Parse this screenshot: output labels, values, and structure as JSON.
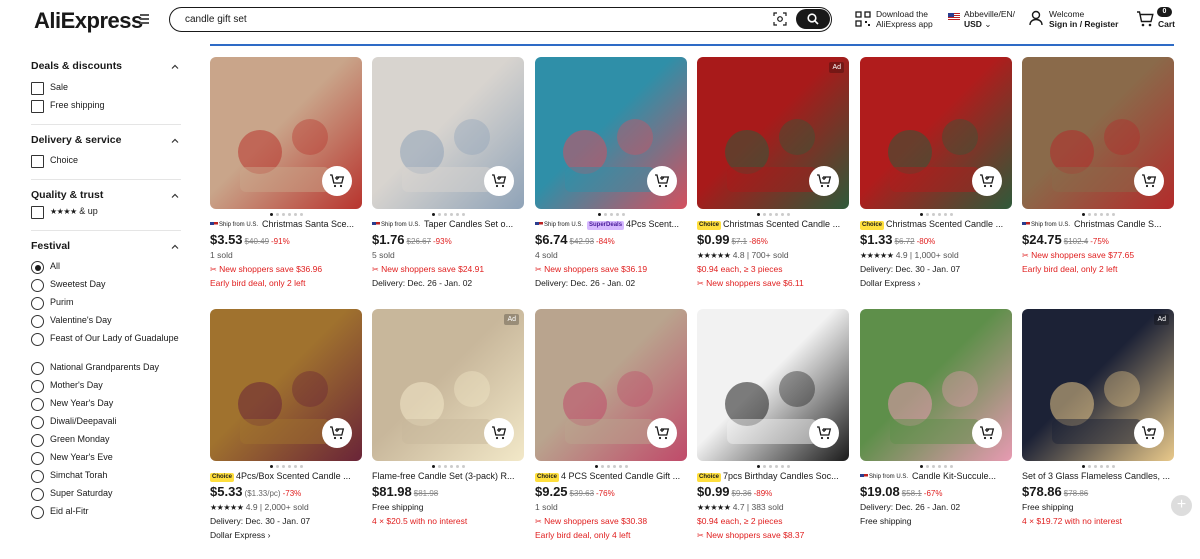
{
  "header": {
    "logo": "AliExpress",
    "search_value": "candle gift set",
    "app_line1": "Download the",
    "app_line2": "AliExpress app",
    "locale_line1": "Abbeville/EN/",
    "locale_line2": "USD",
    "welcome_line1": "Welcome",
    "welcome_line2": "Sign in / Register",
    "cart_count": "0",
    "cart_label": "Cart"
  },
  "sidebar": {
    "deals_title": "Deals & discounts",
    "deals": [
      "Sale",
      "Free shipping"
    ],
    "delivery_title": "Delivery & service",
    "delivery": [
      "Choice"
    ],
    "quality_title": "Quality & trust",
    "quality_stars": "★★★★",
    "quality_label": "& up",
    "festival_title": "Festival",
    "festival": [
      "All",
      "Sweetest Day",
      "Purim",
      "Valentine's Day",
      "Feast of Our Lady of Guadalupe",
      "National Grandparents Day",
      "Mother's Day",
      "New Year's Day",
      "Diwali/Deepavali",
      "Green Monday",
      "New Year's Eve",
      "Simchat Torah",
      "Super Saturday",
      "Eid al-Fitr"
    ]
  },
  "tags": {
    "ship_us": "Ship from U.S.",
    "choice": "Choice",
    "superdeals": "SuperDeals",
    "ad": "Ad"
  },
  "products": [
    {
      "title": "Christmas Santa Sce...",
      "price": "$3.53",
      "old": "$40.49",
      "disc": "-91%",
      "l1": "1 sold",
      "l2": "New shoppers save $36.96",
      "l3": "Early bird deal, only 2 left",
      "colors": [
        "#c9a58a",
        "#b8342e"
      ]
    },
    {
      "title": "Taper Candles Set o...",
      "price": "$1.76",
      "old": "$26.67",
      "disc": "-93%",
      "l1": "5 sold",
      "l2": "New shoppers save $24.91",
      "l3": "Delivery: Dec. 26 - Jan. 02",
      "colors": [
        "#d8d4cf",
        "#8fa3b8"
      ]
    },
    {
      "title": "4Pcs Scent...",
      "price": "$6.74",
      "old": "$42.93",
      "disc": "-84%",
      "l1": "4 sold",
      "l2": "New shoppers save $36.19",
      "l3": "Delivery: Dec. 26 - Jan. 02",
      "colors": [
        "#2f8fa8",
        "#d44f5e"
      ]
    },
    {
      "title": "Christmas Scented Candle ...",
      "price": "$0.99",
      "old": "$7.1",
      "disc": "-86%",
      "stars": "★★★★★",
      "l1": "4.8 | 700+ sold",
      "l2": "$0.94 each, ≥ 3 pieces",
      "l3": "New shoppers save $6.11",
      "colors": [
        "#a81a1a",
        "#2f5a3a"
      ]
    },
    {
      "title": "Christmas Scented Candle ...",
      "price": "$1.33",
      "old": "$6.72",
      "disc": "-80%",
      "stars": "★★★★★",
      "l1": "4.9 | 1,000+ sold",
      "l2": "Delivery: Dec. 30 - Jan. 07",
      "l3": "Dollar Express ›",
      "colors": [
        "#b01c1c",
        "#2f5a3a"
      ]
    },
    {
      "title": "Christmas Candle S...",
      "price": "$24.75",
      "old": "$102.4",
      "disc": "-75%",
      "l1": "New shoppers save $77.65",
      "l2": "Early bird deal, only 2 left",
      "colors": [
        "#8a6a4a",
        "#b32b2b"
      ]
    },
    {
      "title": "4Pcs/Box Scented Candle ...",
      "price": "$5.33",
      "unit": "($1.33/pc)",
      "disc": "-73%",
      "stars": "★★★★★",
      "l1": "4.9 | 2,000+ sold",
      "l2": "Delivery: Dec. 30 - Jan. 07",
      "l3": "Dollar Express ›",
      "colors": [
        "#a0722e",
        "#6a2438"
      ]
    },
    {
      "title": "Flame-free Candle Set (3-pack) R...",
      "price": "$81.98",
      "old": "$81.98",
      "l1": "Free shipping",
      "l2": "4 × $20.5 with no interest",
      "colors": [
        "#c8b79b",
        "#f2e8c8"
      ]
    },
    {
      "title": "4 PCS Scented Candle Gift ...",
      "price": "$9.25",
      "old": "$39.63",
      "disc": "-76%",
      "l1": "1 sold",
      "l2": "New shoppers save $30.38",
      "l3": "Early bird deal, only 4 left",
      "colors": [
        "#b9a48e",
        "#c04a6a"
      ]
    },
    {
      "title": "7pcs Birthday Candles Soc...",
      "price": "$0.99",
      "old": "$9.36",
      "disc": "-89%",
      "stars": "★★★★★",
      "l1": "4.7 | 383 sold",
      "l2": "$0.94 each, ≥ 2 pieces",
      "l3": "New shoppers save $8.37",
      "colors": [
        "#f2f2f2",
        "#1a1a1a"
      ]
    },
    {
      "title": "Candle Kit-Succule...",
      "price": "$19.08",
      "old": "$58.1",
      "disc": "-67%",
      "l1": "Delivery: Dec. 26 - Jan. 02",
      "l2": "Free shipping",
      "colors": [
        "#5e8f4a",
        "#e79ab2"
      ]
    },
    {
      "title": "Set of 3 Glass Flameless Candles, ...",
      "price": "$78.86",
      "old": "$78.86",
      "l1": "Free shipping",
      "l2": "4 × $19.72 with no interest",
      "colors": [
        "#1c2236",
        "#e9c98a"
      ]
    }
  ]
}
